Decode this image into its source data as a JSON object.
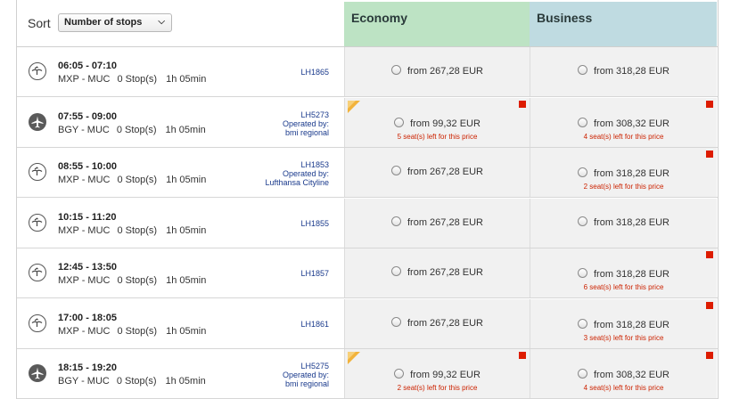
{
  "sort": {
    "label": "Sort",
    "selected": "Number of stops"
  },
  "columns": {
    "economy": "Economy",
    "business": "Business"
  },
  "colors": {
    "economy_header": "#bde3c4",
    "business_header": "#bfdbe1",
    "alert": "#dd1c00",
    "flight_link": "#1a3a8c"
  },
  "flights": [
    {
      "airline_icon": "lufthansa-crane-icon",
      "times": "06:05 - 07:10",
      "route": "MXP - MUC",
      "stops": "0 Stop(s)",
      "duration": "1h 05min",
      "flight_no": "LH1865",
      "operated_by": "",
      "operator": "",
      "economy": {
        "price": "from 267,28 EUR",
        "seats": ""
      },
      "business": {
        "price": "from 318,28 EUR",
        "seats": ""
      }
    },
    {
      "airline_icon": "plane-icon",
      "times": "07:55 - 09:00",
      "route": "BGY - MUC",
      "stops": "0 Stop(s)",
      "duration": "1h 05min",
      "flight_no": "LH5273",
      "operated_by": "Operated by:",
      "operator": "bmi regional",
      "economy": {
        "price": "from 99,32 EUR",
        "seats": "5 seat(s) left for this price"
      },
      "business": {
        "price": "from 308,32 EUR",
        "seats": "4 seat(s) left for this price"
      }
    },
    {
      "airline_icon": "lufthansa-crane-icon",
      "times": "08:55 - 10:00",
      "route": "MXP - MUC",
      "stops": "0 Stop(s)",
      "duration": "1h 05min",
      "flight_no": "LH1853",
      "operated_by": "Operated by:",
      "operator": "Lufthansa Cityline",
      "economy": {
        "price": "from 267,28 EUR",
        "seats": ""
      },
      "business": {
        "price": "from 318,28 EUR",
        "seats": "2 seat(s) left for this price"
      }
    },
    {
      "airline_icon": "lufthansa-crane-icon",
      "times": "10:15 - 11:20",
      "route": "MXP - MUC",
      "stops": "0 Stop(s)",
      "duration": "1h 05min",
      "flight_no": "LH1855",
      "operated_by": "",
      "operator": "",
      "economy": {
        "price": "from 267,28 EUR",
        "seats": ""
      },
      "business": {
        "price": "from 318,28 EUR",
        "seats": ""
      }
    },
    {
      "airline_icon": "lufthansa-crane-icon",
      "times": "12:45 - 13:50",
      "route": "MXP - MUC",
      "stops": "0 Stop(s)",
      "duration": "1h 05min",
      "flight_no": "LH1857",
      "operated_by": "",
      "operator": "",
      "economy": {
        "price": "from 267,28 EUR",
        "seats": ""
      },
      "business": {
        "price": "from 318,28 EUR",
        "seats": "6 seat(s) left for this price"
      }
    },
    {
      "airline_icon": "lufthansa-crane-icon",
      "times": "17:00 - 18:05",
      "route": "MXP - MUC",
      "stops": "0 Stop(s)",
      "duration": "1h 05min",
      "flight_no": "LH1861",
      "operated_by": "",
      "operator": "",
      "economy": {
        "price": "from 267,28 EUR",
        "seats": ""
      },
      "business": {
        "price": "from 318,28 EUR",
        "seats": "3 seat(s) left for this price"
      }
    },
    {
      "airline_icon": "plane-icon",
      "times": "18:15 - 19:20",
      "route": "BGY - MUC",
      "stops": "0 Stop(s)",
      "duration": "1h 05min",
      "flight_no": "LH5275",
      "operated_by": "Operated by:",
      "operator": "bmi regional",
      "economy": {
        "price": "from 99,32 EUR",
        "seats": "2 seat(s) left for this price"
      },
      "business": {
        "price": "from 308,32 EUR",
        "seats": "4 seat(s) left for this price"
      }
    }
  ]
}
